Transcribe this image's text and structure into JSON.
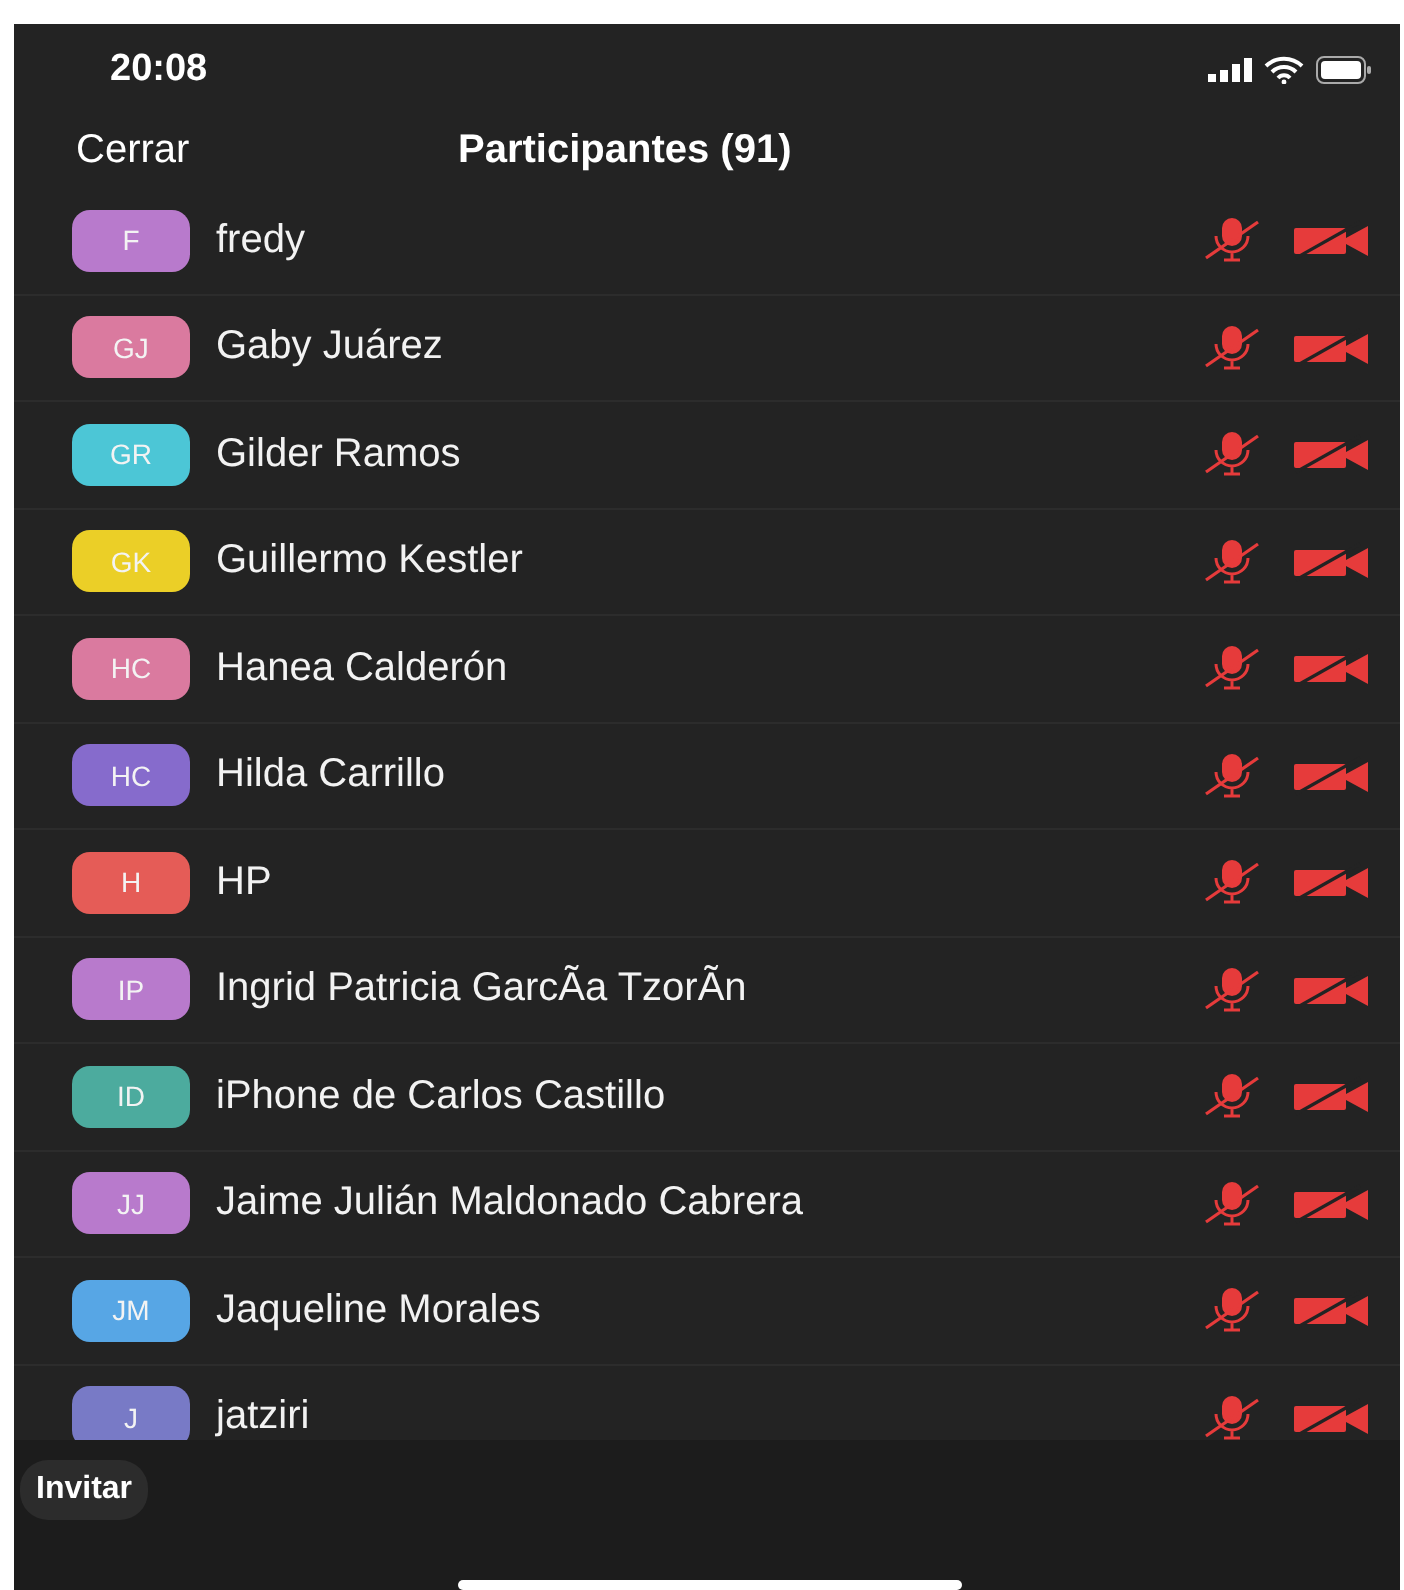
{
  "status_bar": {
    "time": "20:08"
  },
  "header": {
    "close": "Cerrar",
    "title": "Participantes (91)"
  },
  "participants": [
    {
      "initials": "F",
      "name": "fredy",
      "color": "#c17fd6",
      "muted": true,
      "video_off": true
    },
    {
      "initials": "GJ",
      "name": "Gaby Juárez",
      "color": "#e47fa6",
      "muted": true,
      "video_off": true
    },
    {
      "initials": "GR",
      "name": "Gilder Ramos",
      "color": "#4fcfe0",
      "muted": true,
      "video_off": true
    },
    {
      "initials": "GK",
      "name": "Guillermo Kestler",
      "color": "#f6d928",
      "muted": true,
      "video_off": true
    },
    {
      "initials": "HC",
      "name": "Hanea Calderón",
      "color": "#e47fa6",
      "muted": true,
      "video_off": true
    },
    {
      "initials": "HC",
      "name": "Hilda Carrillo",
      "color": "#8c6fd6",
      "muted": true,
      "video_off": true
    },
    {
      "initials": "H",
      "name": "HP",
      "color": "#f0605a",
      "muted": true,
      "video_off": true
    },
    {
      "initials": "IP",
      "name": "Ingrid Patricia GarcÃa TzorÃn",
      "color": "#c17fd6",
      "muted": true,
      "video_off": true
    },
    {
      "initials": "ID",
      "name": "iPhone de Carlos Castillo",
      "color": "#4fb3a5",
      "muted": true,
      "video_off": true
    },
    {
      "initials": "JJ",
      "name": "Jaime Julián Maldonado Cabrera",
      "color": "#c17fd6",
      "muted": true,
      "video_off": true
    },
    {
      "initials": "JM",
      "name": "Jaqueline Morales",
      "color": "#5aaef0",
      "muted": true,
      "video_off": true
    },
    {
      "initials": "J",
      "name": "jatziri",
      "color": "#7d7fcf",
      "muted": true,
      "video_off": true
    }
  ],
  "footer": {
    "invite": "Invitar"
  }
}
